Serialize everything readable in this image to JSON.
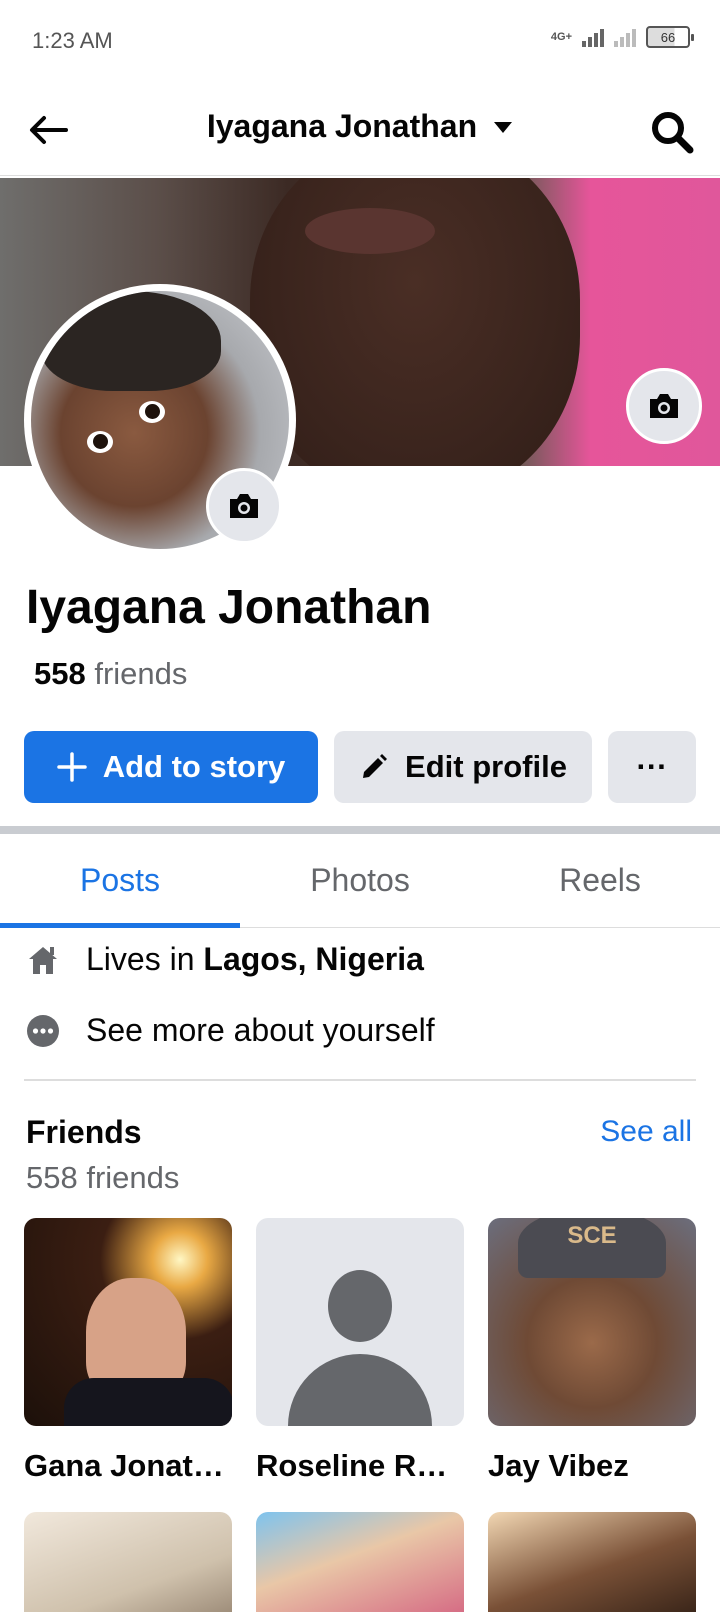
{
  "status_bar": {
    "time": "1:23 AM",
    "network": "4G+",
    "battery": "66"
  },
  "header": {
    "title": "Iyagana Jonathan"
  },
  "profile": {
    "name": "Iyagana Jonathan",
    "friends_count": "558",
    "friends_label": "friends"
  },
  "actions": {
    "add_story": "Add to story",
    "edit_profile": "Edit profile",
    "more": "···"
  },
  "tabs": [
    {
      "label": "Posts"
    },
    {
      "label": "Photos"
    },
    {
      "label": "Reels"
    }
  ],
  "details": {
    "lives_prefix": "Lives in",
    "lives_place": "Lagos, Nigeria",
    "see_more": "See more about yourself"
  },
  "friends_section": {
    "title": "Friends",
    "see_all": "See all",
    "subtitle": "558 friends",
    "items": [
      {
        "name": "Gana Jonathan"
      },
      {
        "name": "Roseline Roseline"
      },
      {
        "name": "Jay Vibez"
      }
    ],
    "cap_text": "SCE"
  }
}
